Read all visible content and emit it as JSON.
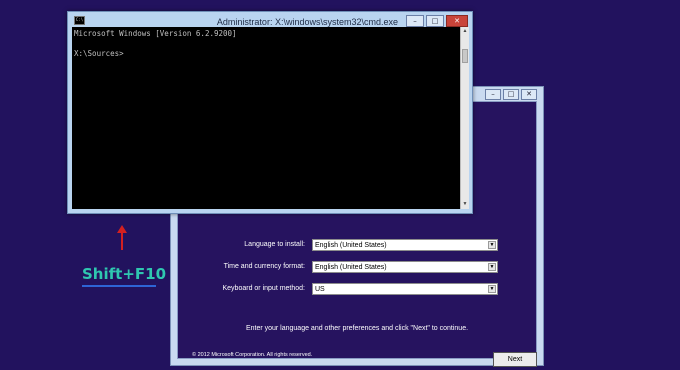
{
  "cmd": {
    "title": "Administrator: X:\\windows\\system32\\cmd.exe",
    "icon": "C:\\",
    "output_lines": [
      "Microsoft Windows [Version 6.2.9200]",
      "",
      "X:\\Sources>"
    ],
    "minimize": "–",
    "maximize": "□",
    "close": "✕"
  },
  "setup": {
    "minimize": "–",
    "maximize": "□",
    "close": "✕",
    "language_label": "Language to install:",
    "language_value": "English (United States)",
    "time_label": "Time and currency format:",
    "time_value": "English (United States)",
    "keyboard_label": "Keyboard or input method:",
    "keyboard_value": "US",
    "dropdown_arrow": "▼",
    "instruction": "Enter your language and other preferences and click \"Next\" to continue.",
    "copyright": "© 2012 Microsoft Corporation. All rights reserved.",
    "next_label": "Next"
  },
  "annotation": {
    "shortcut": "Shift+F10",
    "arrow_color": "#d32020",
    "label_color": "#2fc7b0"
  },
  "colors": {
    "background": "#22125e",
    "cmd_frame": "#b9d4f0",
    "console_bg": "#000000",
    "console_text": "#c0c0c0"
  }
}
